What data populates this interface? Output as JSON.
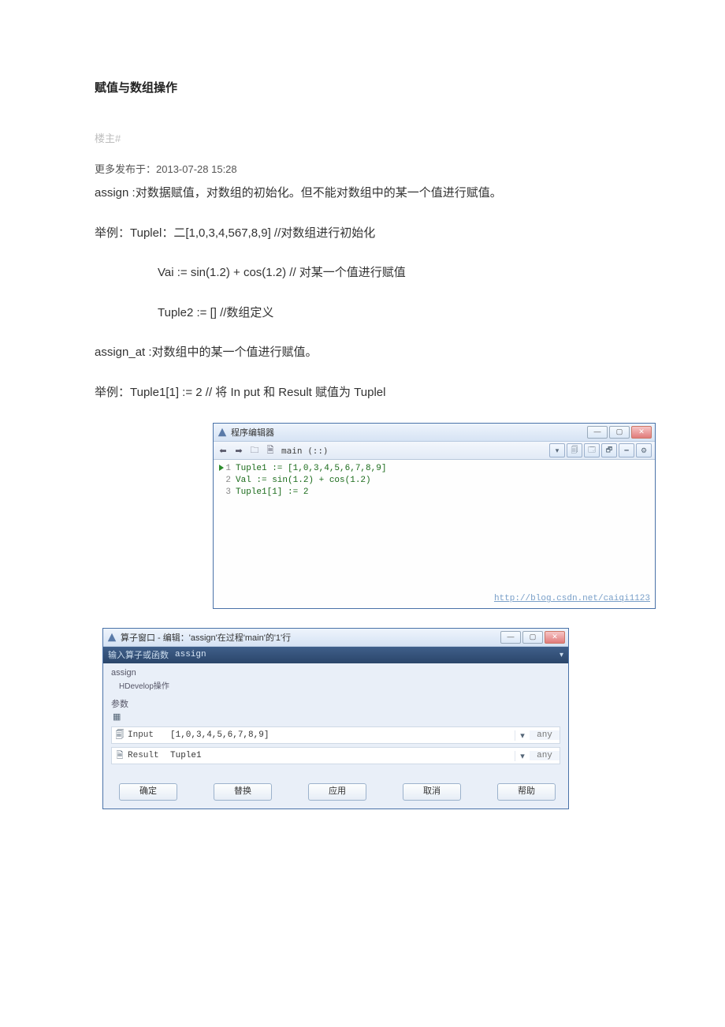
{
  "doc": {
    "title": "赋值与数组操作",
    "author": "楼主#",
    "meta": "更多发布于：2013-07-28 15:28",
    "assign_line": "assign :对数据赋值，对数组的初始化。但不能对数组中的某一个值进行赋值。",
    "example_label": "举例：",
    "tuple_init": "Tuplel：二[1,0,3,4,567,8,9] //对数组进行初始化",
    "vai_line": "Vai := sin(1.2) + cos(1.2)      //    对某一个值进行赋值",
    "tuple2_line": "Tuple2 := []                                   //数组定义",
    "assign_at": "assign_at :对数组中的某一个值进行赋值。",
    "example2": "Tuple1[1] := 2                     // 将  In put 和  Result 赋值为 Tuplel"
  },
  "editor": {
    "title": "程序编辑器",
    "file": "main (::)",
    "code1": "Tuple1 := [1,0,3,4,5,6,7,8,9]",
    "code2": "Val := sin(1.2) + cos(1.2)",
    "code3": "Tuple1[1] := 2",
    "watermark": "http://blog.csdn.net/caiqi1123"
  },
  "op_win": {
    "title": "算子窗口 - 编辑：'assign'在过程'main'的'1'行",
    "field_label": "输入算子或函数",
    "field_value": "assign",
    "group": "assign",
    "group_sub": "HDevelop操作",
    "param_head": "参数",
    "input_label": "Input",
    "input_value": "[1,0,3,4,5,6,7,8,9]",
    "result_label": "Result",
    "result_value": "Tuple1",
    "type_any": "any",
    "btn_ok": "确定",
    "btn_replace": "替换",
    "btn_apply": "应用",
    "btn_cancel": "取消",
    "btn_help": "帮助"
  }
}
